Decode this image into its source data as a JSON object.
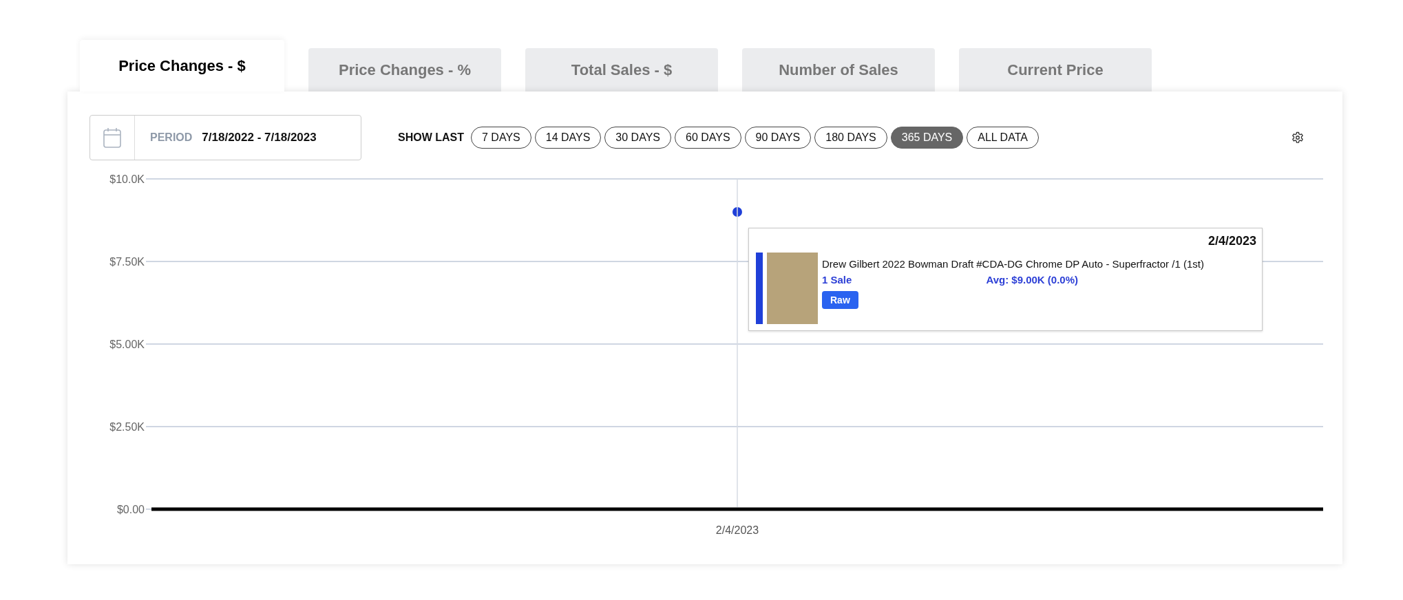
{
  "tabs": [
    {
      "label": "Price Changes - $",
      "selected": true
    },
    {
      "label": "Price Changes - %",
      "selected": false
    },
    {
      "label": "Total Sales - $",
      "selected": false
    },
    {
      "label": "Number of Sales",
      "selected": false
    },
    {
      "label": "Current Price",
      "selected": false
    }
  ],
  "period": {
    "label": "PERIOD",
    "value": "7/18/2022 - 7/18/2023"
  },
  "show_last": {
    "label": "SHOW LAST",
    "options": [
      {
        "label": "7 DAYS",
        "selected": false
      },
      {
        "label": "14 DAYS",
        "selected": false
      },
      {
        "label": "30 DAYS",
        "selected": false
      },
      {
        "label": "60 DAYS",
        "selected": false
      },
      {
        "label": "90 DAYS",
        "selected": false
      },
      {
        "label": "180 DAYS",
        "selected": false
      },
      {
        "label": "365 DAYS",
        "selected": true
      },
      {
        "label": "ALL DATA",
        "selected": false
      }
    ]
  },
  "chart": {
    "chart_data": {
      "type": "scatter",
      "categories": [
        "2/4/2023"
      ],
      "series": [
        {
          "name": "Drew Gilbert 2022 Bowman Draft #CDA-DG Chrome DP Auto - Superfractor /1 (1st)",
          "color": "#1f3fd8",
          "values": [
            9000
          ]
        }
      ],
      "ylim": [
        0,
        10000
      ],
      "grid": true,
      "yticks": [
        {
          "value": 0,
          "label": "$0.00"
        },
        {
          "value": 2500,
          "label": "$2.50K"
        },
        {
          "value": 5000,
          "label": "$5.00K"
        },
        {
          "value": 7500,
          "label": "$7.50K"
        },
        {
          "value": 10000,
          "label": "$10.0K"
        }
      ]
    },
    "tooltip": {
      "date": "2/4/2023",
      "sales": "1 Sale",
      "avg": "Avg: $9.00K (0.0%)",
      "badge": "Raw"
    }
  }
}
